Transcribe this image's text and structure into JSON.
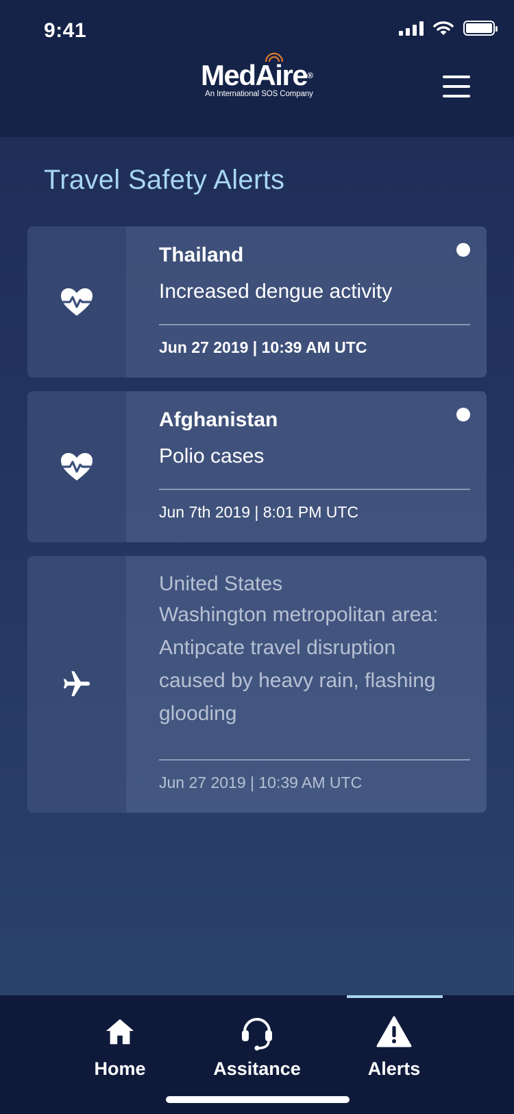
{
  "status_bar": {
    "time": "9:41",
    "icons": [
      "cellular-signal-icon",
      "wifi-icon",
      "battery-icon"
    ]
  },
  "header": {
    "logo_text": "MedAire",
    "logo_registered": "®",
    "logo_tagline": "An International SOS Company",
    "menu_icon": "hamburger-menu-icon"
  },
  "page": {
    "title": "Travel Safety Alerts"
  },
  "alerts": [
    {
      "country": "Thailand",
      "description": "Increased dengue activity",
      "datetime": "Jun 27 2019 | 10:39 AM UTC",
      "icon": "heart-pulse-icon",
      "unread": true
    },
    {
      "country": "Afghanistan",
      "description": "Polio cases",
      "datetime": "Jun 7th 2019 | 8:01 PM UTC",
      "icon": "heart-pulse-icon",
      "unread": true
    },
    {
      "country": "United States",
      "description_lines": [
        "Washington metropolitan area:",
        "Antipcate travel disruption",
        "caused by heavy rain, flashing",
        "glooding"
      ],
      "datetime": "Jun 27 2019 | 10:39 AM UTC",
      "icon": "airplane-icon",
      "unread": false
    }
  ],
  "bottom_nav": {
    "items": [
      {
        "label": "Home",
        "icon": "home-icon",
        "active": false
      },
      {
        "label": "Assitance",
        "icon": "headset-icon",
        "active": false
      },
      {
        "label": "Alerts",
        "icon": "warning-icon",
        "active": true
      }
    ]
  },
  "colors": {
    "header_bg": "#152348",
    "title": "#a9d6f2",
    "nav_bg": "#0f1a3b",
    "logo_arc": "#e07a2a",
    "active_indicator": "#a9d6f2"
  }
}
